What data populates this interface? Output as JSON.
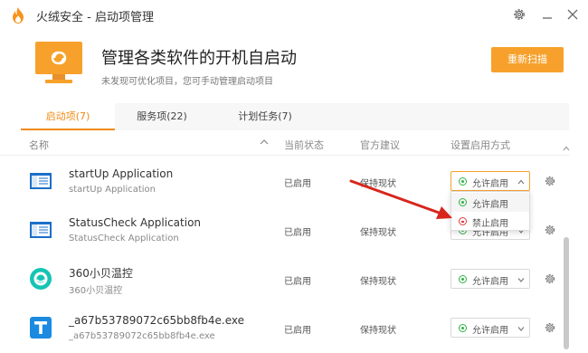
{
  "window": {
    "title": "火绒安全 - 启动项管理"
  },
  "header": {
    "title": "管理各类软件的开机自启动",
    "subtitle": "未发现可优化项目，您可手动管理启动项目",
    "rescan_label": "重新扫描"
  },
  "tabs": [
    {
      "label": "启动项(7)",
      "active": true
    },
    {
      "label": "服务项(22)",
      "active": false
    },
    {
      "label": "计划任务(7)",
      "active": false
    }
  ],
  "columns": {
    "name": "名称",
    "state": "当前状态",
    "advice": "官方建议",
    "mode": "设置启用方式"
  },
  "rows": [
    {
      "name": "startUp Application",
      "sub": "startUp Application",
      "state": "已启用",
      "advice": "保持现状",
      "mode": "允许启用",
      "icon": "window-app-icon"
    },
    {
      "name": "StatusCheck Application",
      "sub": "StatusCheck Application",
      "state": "已启用",
      "advice": "保持现状",
      "mode": "允许启用",
      "icon": "window-app-icon"
    },
    {
      "name": "360小贝温控",
      "sub": "360小贝温控",
      "state": "已启用",
      "advice": "保持现状",
      "mode": "允许启用",
      "icon": "360-temp-icon"
    },
    {
      "name": "_a67b53789072c65bb8fb4e.exe",
      "sub": "_a67b53789072c65bb8fb4e.exe",
      "state": "已启用",
      "advice": "保持现状",
      "mode": "允许启用",
      "icon": "t-app-icon"
    }
  ],
  "dropdown": {
    "options": [
      "允许启用",
      "禁止启用"
    ],
    "selected": "允许启用"
  },
  "colors": {
    "accent": "#f7a12c",
    "tab_active": "#f08a14",
    "allow": "#2fb344",
    "ban": "#e03b3b",
    "annotation_arrow": "#d7261c"
  }
}
